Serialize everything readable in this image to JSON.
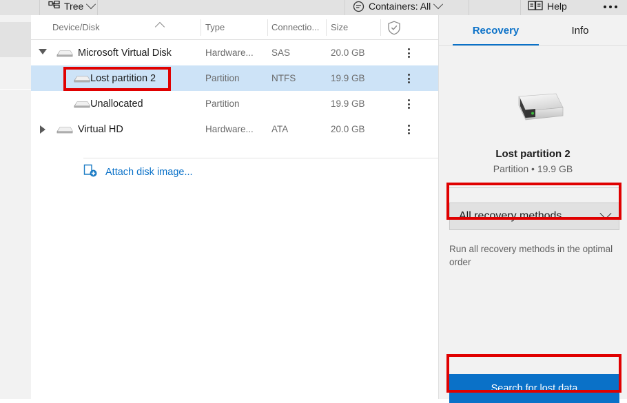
{
  "toolbar": {
    "tree_label": "Tree",
    "tree_icon": "tree-hierarchy-icon",
    "containers_label": "Containers: All",
    "containers_icon": "filter-icon",
    "help_label": "Help",
    "help_icon": "book-help-icon",
    "overflow_icon": "more-horizontal-icon"
  },
  "tree": {
    "columns": [
      {
        "id": "device",
        "label": "Device/Disk",
        "sorted": "ascending"
      },
      {
        "id": "type",
        "label": "Type"
      },
      {
        "id": "connection",
        "label": "Connectio..."
      },
      {
        "id": "size",
        "label": "Size"
      },
      {
        "id": "protection",
        "label": "",
        "icon": "shield-check-icon"
      }
    ],
    "rows": [
      {
        "name": "Microsoft Virtual Disk",
        "type": "Hardware...",
        "connection": "SAS",
        "size": "20.0 GB",
        "level": 0,
        "twisty": "expanded",
        "selected": false
      },
      {
        "name": "Lost partition 2",
        "type": "Partition",
        "connection": "NTFS",
        "size": "19.9 GB",
        "level": 1,
        "twisty": "none",
        "selected": true
      },
      {
        "name": "Unallocated",
        "type": "Partition",
        "connection": "",
        "size": "19.9 GB",
        "level": 1,
        "twisty": "none",
        "selected": false
      },
      {
        "name": "Virtual HD",
        "type": "Hardware...",
        "connection": "ATA",
        "size": "20.0 GB",
        "level": 0,
        "twisty": "collapsed",
        "selected": false
      }
    ],
    "attach_label": "Attach disk image...",
    "attach_icon": "attach-disk-image-icon",
    "row_menu_icon": "more-vertical-icon"
  },
  "right_panel": {
    "tabs": [
      {
        "label": "Recovery",
        "active": true
      },
      {
        "label": "Info",
        "active": false
      }
    ],
    "device_icon": "external-drive-icon",
    "device_title": "Lost partition 2",
    "device_subtitle": "Partition • 19.9 GB",
    "capacity_bar_fill_percent": 0,
    "method_label": "All recovery methods",
    "method_chevron_icon": "chevron-down-icon",
    "method_description": "Run all recovery methods in the optimal order",
    "search_button_label": "Search for lost data"
  },
  "annotations": {
    "color": "#e00000",
    "targets": [
      "lost-partition-2-row-name",
      "recovery-method-select",
      "search-for-lost-data-button"
    ]
  }
}
